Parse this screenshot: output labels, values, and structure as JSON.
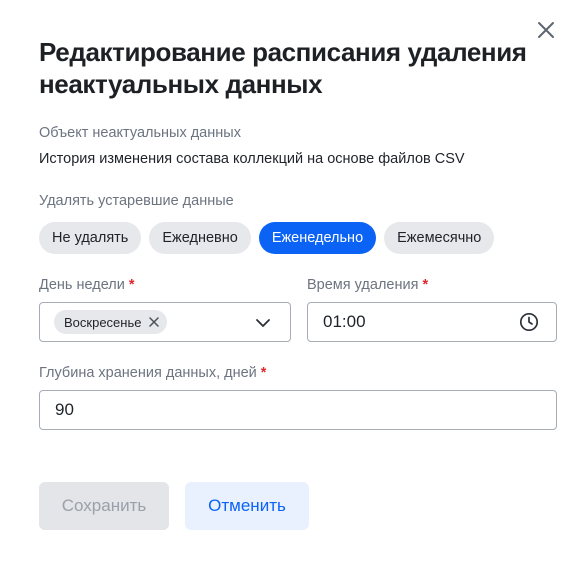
{
  "dialog": {
    "title": "Редактирование расписания удаления неактуальных данных",
    "close_icon": "close-icon"
  },
  "object": {
    "label": "Объект неактуальных данных",
    "value": "История изменения состава коллекций на основе файлов CSV"
  },
  "schedule": {
    "label": "Удалять устаревшие данные",
    "options": [
      {
        "label": "Не удалять",
        "selected": false
      },
      {
        "label": "Ежедневно",
        "selected": false
      },
      {
        "label": "Еженедельно",
        "selected": true
      },
      {
        "label": "Ежемесячно",
        "selected": false
      }
    ]
  },
  "weekday": {
    "label": "День недели",
    "required_mark": "*",
    "selected_chip": "Воскресенье",
    "chip_remove_icon": "close-icon",
    "dropdown_icon": "chevron-down-icon"
  },
  "time": {
    "label": "Время удаления",
    "required_mark": "*",
    "value": "01:00",
    "icon": "clock-icon"
  },
  "depth": {
    "label": "Глубина хранения данных, дней",
    "required_mark": "*",
    "value": "90"
  },
  "actions": {
    "save_label": "Сохранить",
    "save_disabled": true,
    "cancel_label": "Отменить"
  },
  "colors": {
    "accent": "#0b63f6",
    "required": "#e0262d",
    "segment_bg": "#e6e8eb",
    "disabled_bg": "#e3e5e8",
    "cancel_bg": "#e9f1fe"
  }
}
